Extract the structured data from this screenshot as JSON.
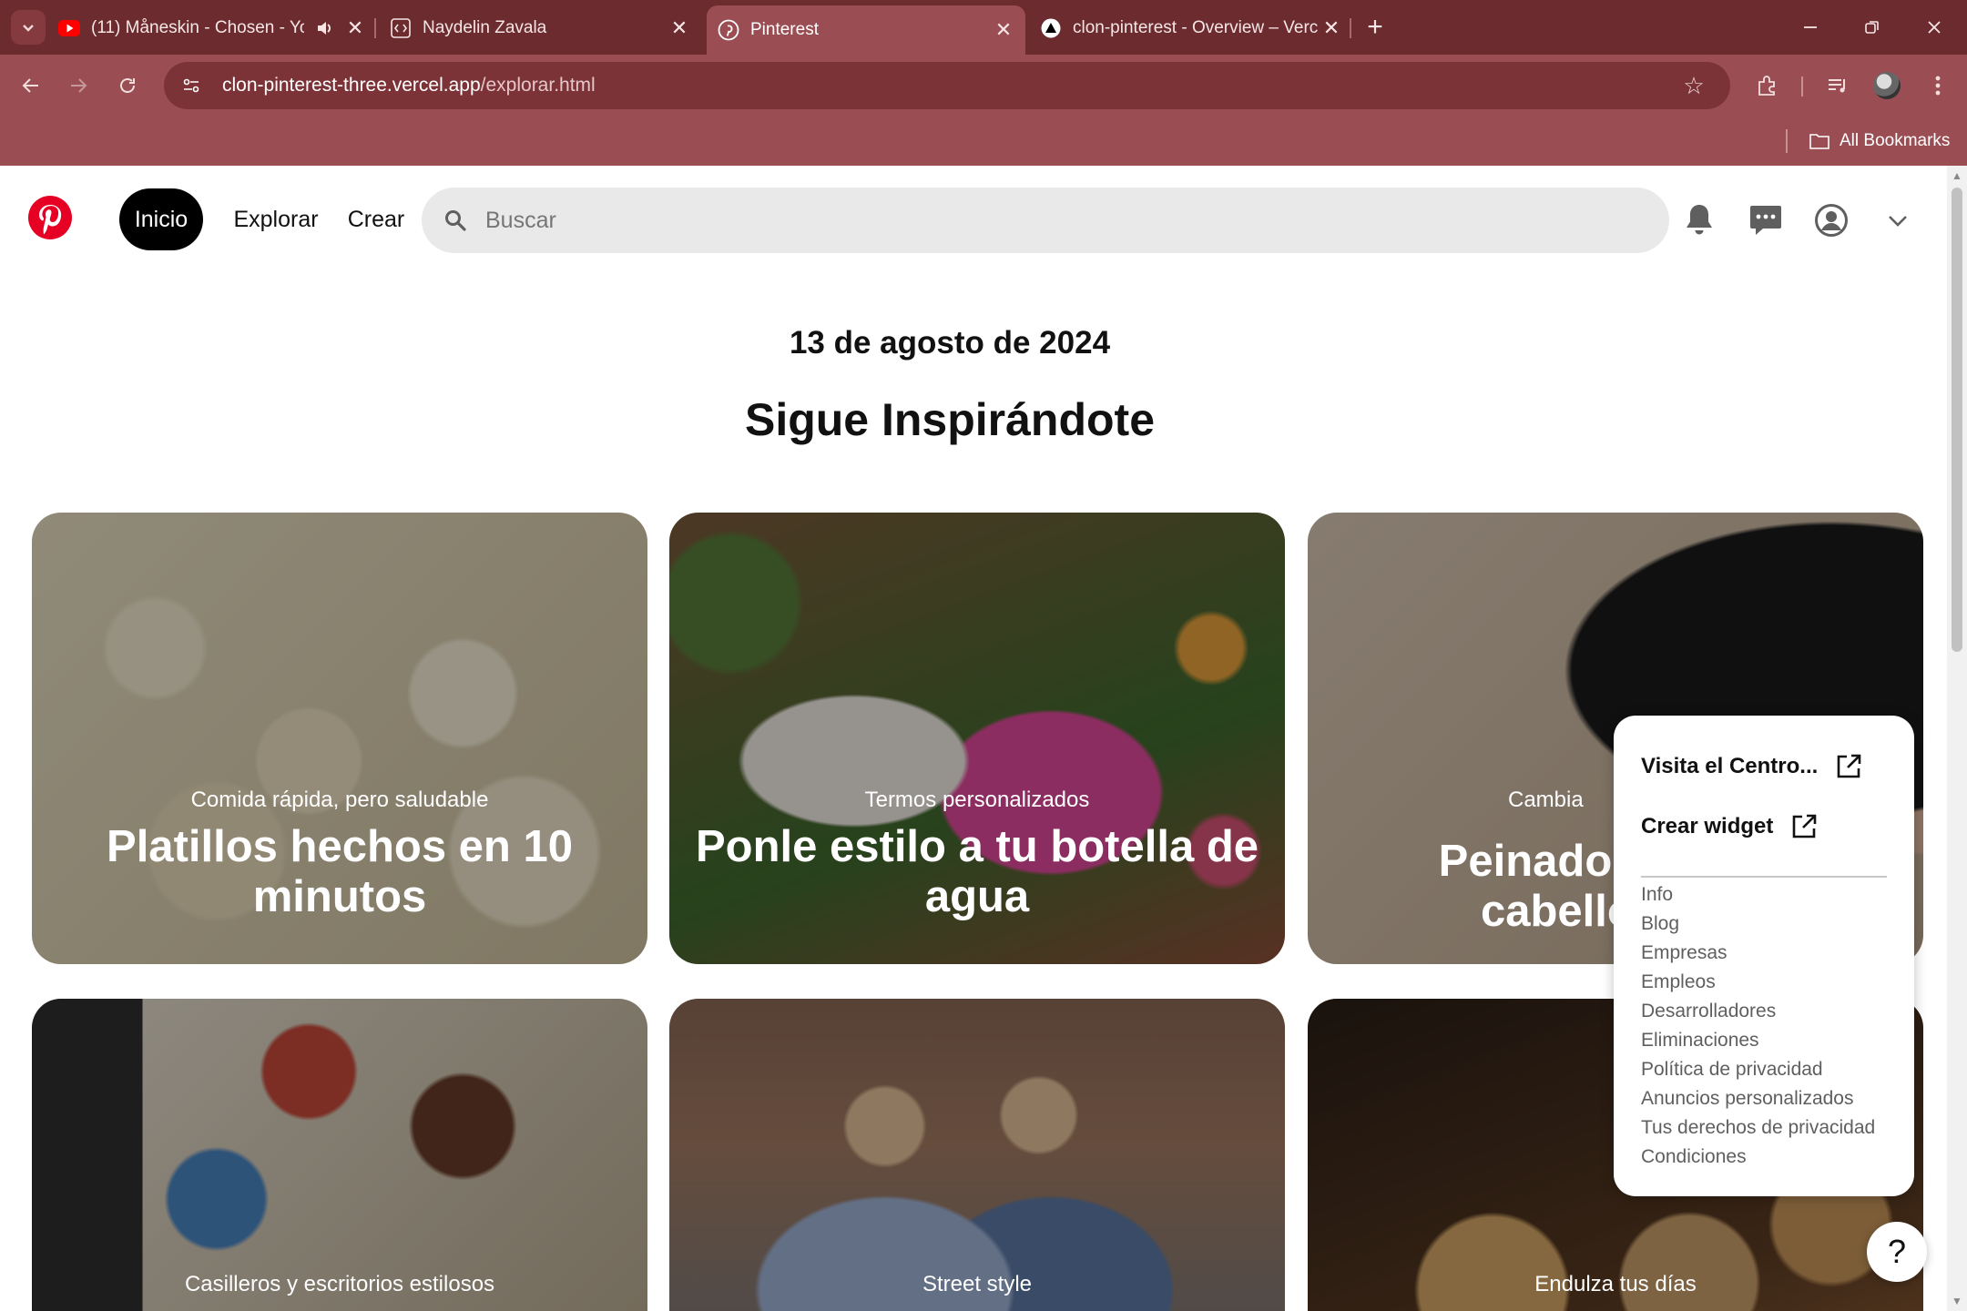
{
  "browser": {
    "tabs": [
      {
        "title": "(11) Måneskin - Chosen - Yo",
        "favicon": "youtube-icon",
        "audio": true
      },
      {
        "title": "Naydelin Zavala",
        "favicon": "code-icon"
      },
      {
        "title": "Pinterest",
        "favicon": "pinterest-icon",
        "active": true
      },
      {
        "title": "clon-pinterest - Overview – Verc",
        "favicon": "vercel-icon"
      }
    ],
    "url_host": "clon-pinterest-three.vercel.app",
    "url_path": "/explorar.html",
    "bookmarks_label": "All Bookmarks"
  },
  "header": {
    "nav": {
      "home": "Inicio",
      "explore": "Explorar",
      "create": "Crear"
    },
    "search_placeholder": "Buscar"
  },
  "main": {
    "date": "13 de agosto de 2024",
    "title": "Sigue Inspirándote",
    "cards": [
      {
        "subtitle": "Comida rápida, pero saludable",
        "title": "Platillos hechos en 10 minutos"
      },
      {
        "subtitle": "Termos personalizados",
        "title": "Ponle estilo a tu botella de agua"
      },
      {
        "subtitle": "Cambia",
        "title": "Peinados pe cabellos"
      },
      {
        "subtitle": "Casilleros y escritorios estilosos",
        "title": ""
      },
      {
        "subtitle": "Street style",
        "title": ""
      },
      {
        "subtitle": "Endulza tus días",
        "title": ""
      }
    ]
  },
  "menu": {
    "visit_center": "Visita el Centro...",
    "create_widget": "Crear widget",
    "links": [
      "Info",
      "Blog",
      "Empresas",
      "Empleos",
      "Desarrolladores",
      "Eliminaciones",
      "Política de privacidad",
      "Anuncios personalizados",
      "Tus derechos de privacidad",
      "Condiciones"
    ]
  },
  "help_label": "?",
  "colors": {
    "brand": "#e60023",
    "chrome_dark": "#6b2b2f",
    "chrome": "#9a4e53"
  }
}
